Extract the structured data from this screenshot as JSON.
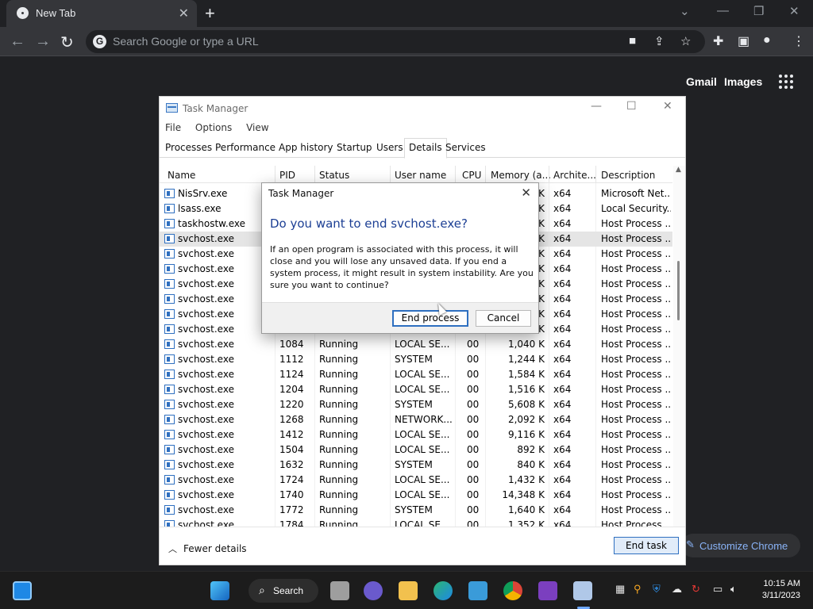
{
  "browser": {
    "tab_title": "New Tab",
    "omnibox_placeholder": "Search Google or type a URL",
    "links": {
      "gmail": "Gmail",
      "images": "Images"
    },
    "customize_label": "Customize Chrome"
  },
  "task_manager": {
    "title": "Task Manager",
    "menu": [
      "File",
      "Options",
      "View"
    ],
    "tabs": [
      "Processes",
      "Performance",
      "App history",
      "Startup",
      "Users",
      "Details",
      "Services"
    ],
    "active_tab": "Details",
    "columns": [
      "Name",
      "PID",
      "Status",
      "User name",
      "CPU",
      "Memory (a...",
      "Archite...",
      "Description"
    ],
    "rows": [
      {
        "name": "NisSrv.exe",
        "pid": "",
        "status": "",
        "user": "",
        "cpu": "",
        "mem": "K",
        "arch": "x64",
        "desc": "Microsoft Net..."
      },
      {
        "name": "lsass.exe",
        "pid": "",
        "status": "",
        "user": "",
        "cpu": "",
        "mem": "K",
        "arch": "x64",
        "desc": "Local Security..."
      },
      {
        "name": "taskhostw.exe",
        "pid": "",
        "status": "",
        "user": "",
        "cpu": "",
        "mem": "K",
        "arch": "x64",
        "desc": "Host Process ..."
      },
      {
        "name": "svchost.exe",
        "pid": "",
        "status": "",
        "user": "",
        "cpu": "",
        "mem": "K",
        "arch": "x64",
        "desc": "Host Process ...",
        "selected": true
      },
      {
        "name": "svchost.exe",
        "pid": "",
        "status": "",
        "user": "",
        "cpu": "",
        "mem": "K",
        "arch": "x64",
        "desc": "Host Process ..."
      },
      {
        "name": "svchost.exe",
        "pid": "",
        "status": "",
        "user": "",
        "cpu": "",
        "mem": "K",
        "arch": "x64",
        "desc": "Host Process ..."
      },
      {
        "name": "svchost.exe",
        "pid": "",
        "status": "",
        "user": "",
        "cpu": "",
        "mem": "K",
        "arch": "x64",
        "desc": "Host Process ..."
      },
      {
        "name": "svchost.exe",
        "pid": "",
        "status": "",
        "user": "",
        "cpu": "",
        "mem": "K",
        "arch": "x64",
        "desc": "Host Process ..."
      },
      {
        "name": "svchost.exe",
        "pid": "",
        "status": "",
        "user": "",
        "cpu": "",
        "mem": "K",
        "arch": "x64",
        "desc": "Host Process ..."
      },
      {
        "name": "svchost.exe",
        "pid": "",
        "status": "",
        "user": "",
        "cpu": "",
        "mem": "K",
        "arch": "x64",
        "desc": "Host Process ..."
      },
      {
        "name": "svchost.exe",
        "pid": "1084",
        "status": "Running",
        "user": "LOCAL SE...",
        "cpu": "00",
        "mem": "1,040 K",
        "arch": "x64",
        "desc": "Host Process ..."
      },
      {
        "name": "svchost.exe",
        "pid": "1112",
        "status": "Running",
        "user": "SYSTEM",
        "cpu": "00",
        "mem": "1,244 K",
        "arch": "x64",
        "desc": "Host Process ..."
      },
      {
        "name": "svchost.exe",
        "pid": "1124",
        "status": "Running",
        "user": "LOCAL SE...",
        "cpu": "00",
        "mem": "1,584 K",
        "arch": "x64",
        "desc": "Host Process ..."
      },
      {
        "name": "svchost.exe",
        "pid": "1204",
        "status": "Running",
        "user": "LOCAL SE...",
        "cpu": "00",
        "mem": "1,516 K",
        "arch": "x64",
        "desc": "Host Process ..."
      },
      {
        "name": "svchost.exe",
        "pid": "1220",
        "status": "Running",
        "user": "SYSTEM",
        "cpu": "00",
        "mem": "5,608 K",
        "arch": "x64",
        "desc": "Host Process ..."
      },
      {
        "name": "svchost.exe",
        "pid": "1268",
        "status": "Running",
        "user": "NETWORK...",
        "cpu": "00",
        "mem": "2,092 K",
        "arch": "x64",
        "desc": "Host Process ..."
      },
      {
        "name": "svchost.exe",
        "pid": "1412",
        "status": "Running",
        "user": "LOCAL SE...",
        "cpu": "00",
        "mem": "9,116 K",
        "arch": "x64",
        "desc": "Host Process ..."
      },
      {
        "name": "svchost.exe",
        "pid": "1504",
        "status": "Running",
        "user": "LOCAL SE...",
        "cpu": "00",
        "mem": "892 K",
        "arch": "x64",
        "desc": "Host Process ..."
      },
      {
        "name": "svchost.exe",
        "pid": "1632",
        "status": "Running",
        "user": "SYSTEM",
        "cpu": "00",
        "mem": "840 K",
        "arch": "x64",
        "desc": "Host Process ..."
      },
      {
        "name": "svchost.exe",
        "pid": "1724",
        "status": "Running",
        "user": "LOCAL SE...",
        "cpu": "00",
        "mem": "1,432 K",
        "arch": "x64",
        "desc": "Host Process ..."
      },
      {
        "name": "svchost.exe",
        "pid": "1740",
        "status": "Running",
        "user": "LOCAL SE...",
        "cpu": "00",
        "mem": "14,348 K",
        "arch": "x64",
        "desc": "Host Process ..."
      },
      {
        "name": "svchost.exe",
        "pid": "1772",
        "status": "Running",
        "user": "SYSTEM",
        "cpu": "00",
        "mem": "1,640 K",
        "arch": "x64",
        "desc": "Host Process ..."
      },
      {
        "name": "svchost.exe",
        "pid": "1784",
        "status": "Running",
        "user": "LOCAL SE...",
        "cpu": "00",
        "mem": "1,352 K",
        "arch": "x64",
        "desc": "Host Process ..."
      }
    ],
    "footer": {
      "fewer_details": "Fewer details",
      "end_task": "End task"
    }
  },
  "dialog": {
    "title": "Task Manager",
    "question": "Do you want to end svchost.exe?",
    "message": "If an open program is associated with this process, it will close and you will lose any unsaved data. If you end a system process, it might result in system instability. Are you sure you want to continue?",
    "end_process": "End process",
    "cancel": "Cancel"
  },
  "taskbar": {
    "search_label": "Search",
    "time": "10:15 AM",
    "date": "3/11/2023"
  },
  "colors": {
    "accent": "#2e6fc0",
    "dialog_heading": "#1c3f94",
    "chrome_link": "#8ab4f8"
  }
}
